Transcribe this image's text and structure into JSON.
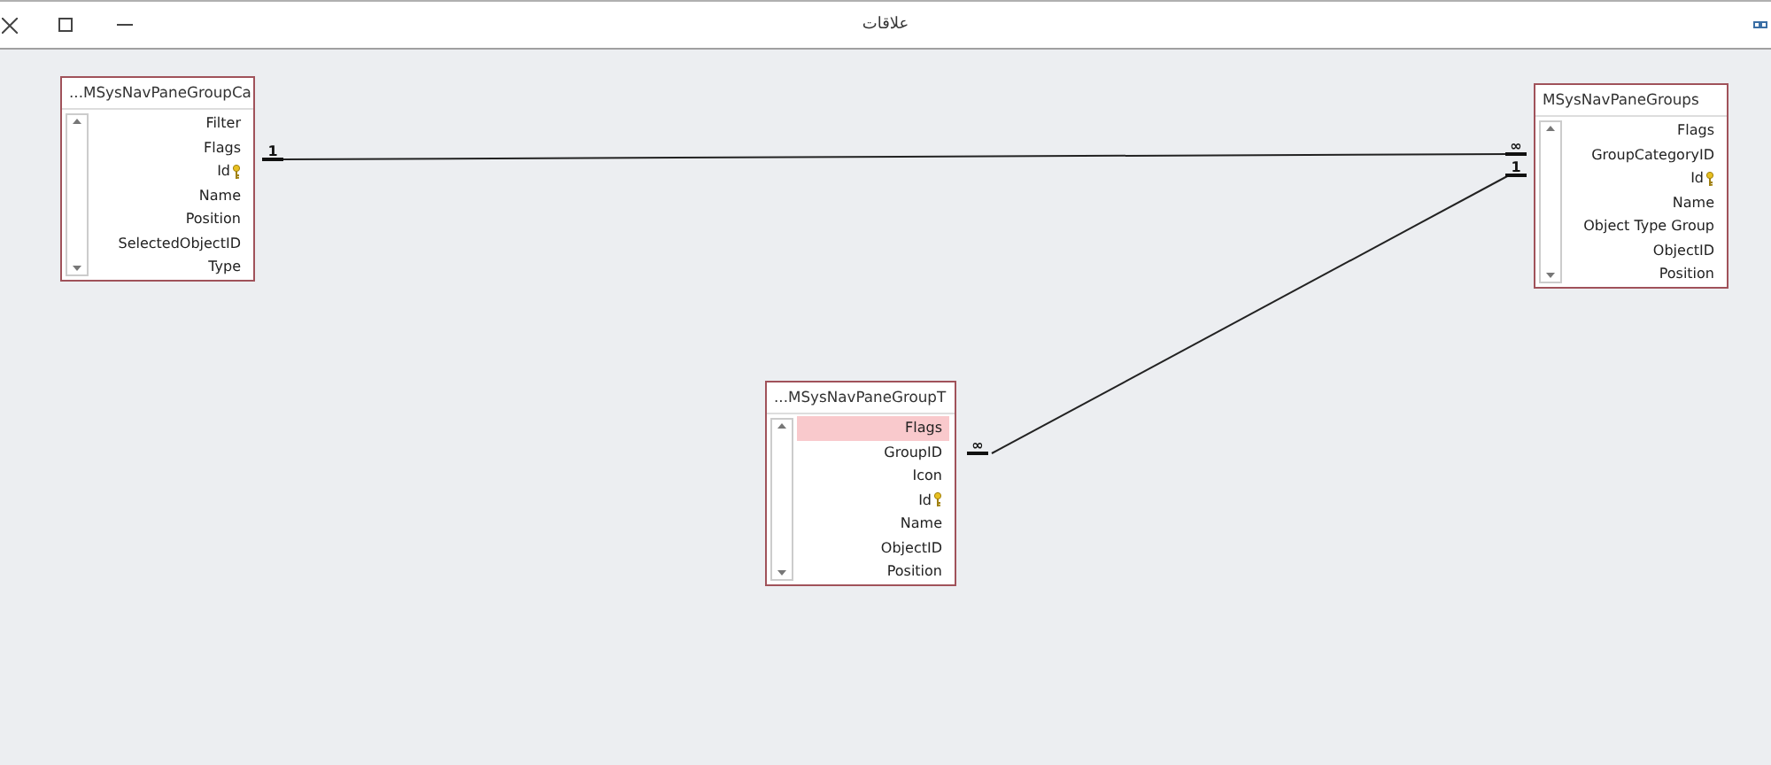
{
  "window": {
    "title": "علاقات"
  },
  "tables": [
    {
      "name": "...MSysNavPaneGroupCa",
      "fields": [
        {
          "name": "Filter",
          "key": false,
          "selected": false
        },
        {
          "name": "Flags",
          "key": false,
          "selected": false
        },
        {
          "name": "Id",
          "key": true,
          "selected": false
        },
        {
          "name": "Name",
          "key": false,
          "selected": false
        },
        {
          "name": "Position",
          "key": false,
          "selected": false
        },
        {
          "name": "SelectedObjectID",
          "key": false,
          "selected": false
        },
        {
          "name": "Type",
          "key": false,
          "selected": false
        }
      ]
    },
    {
      "name": "MSysNavPaneGroups",
      "fields": [
        {
          "name": "Flags",
          "key": false,
          "selected": false
        },
        {
          "name": "GroupCategoryID",
          "key": false,
          "selected": false
        },
        {
          "name": "Id",
          "key": true,
          "selected": false
        },
        {
          "name": "Name",
          "key": false,
          "selected": false
        },
        {
          "name": "Object Type Group",
          "key": false,
          "selected": false
        },
        {
          "name": "ObjectID",
          "key": false,
          "selected": false
        },
        {
          "name": "Position",
          "key": false,
          "selected": false
        }
      ]
    },
    {
      "name": "...MSysNavPaneGroupT",
      "fields": [
        {
          "name": "Flags",
          "key": false,
          "selected": true
        },
        {
          "name": "GroupID",
          "key": false,
          "selected": false
        },
        {
          "name": "Icon",
          "key": false,
          "selected": false
        },
        {
          "name": "Id",
          "key": true,
          "selected": false
        },
        {
          "name": "Name",
          "key": false,
          "selected": false
        },
        {
          "name": "ObjectID",
          "key": false,
          "selected": false
        },
        {
          "name": "Position",
          "key": false,
          "selected": false
        }
      ]
    }
  ],
  "relationships": [
    {
      "from_end": "1",
      "to_end": "∞"
    },
    {
      "from_end": "∞",
      "to_end": "1"
    }
  ]
}
